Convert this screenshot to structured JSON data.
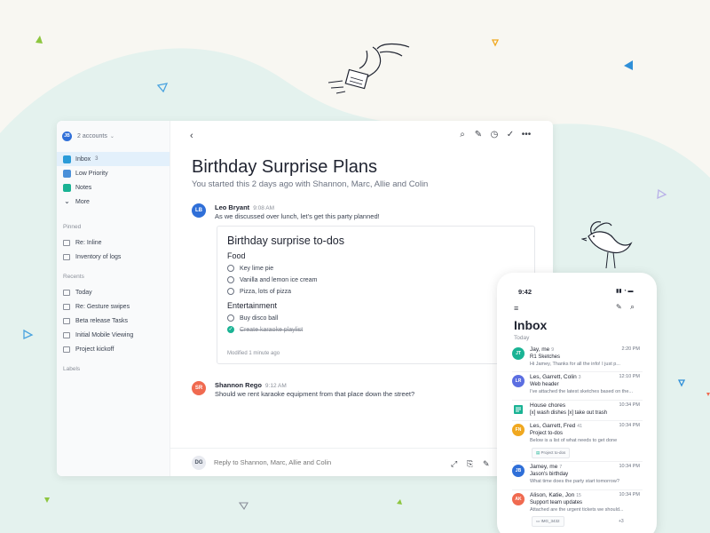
{
  "colors": {
    "accent": "#2f6fd8",
    "teal": "#1ab394",
    "background": "#f8f7f2",
    "blob": "#e4f2ee"
  },
  "desktop": {
    "account": {
      "initials": "JB",
      "label": "2 accounts"
    },
    "nav": [
      {
        "label": "Inbox",
        "badge": "3",
        "icon": "inbox-icon",
        "color": "#2a9bd8"
      },
      {
        "label": "Low Priority",
        "badge": "",
        "icon": "low-priority-icon",
        "color": "#4a90d9"
      },
      {
        "label": "Notes",
        "badge": "",
        "icon": "notes-icon",
        "color": "#1ab394"
      },
      {
        "label": "More",
        "badge": "",
        "icon": "chevron-down-icon",
        "color": ""
      }
    ],
    "pinned_label": "Pinned",
    "pinned": [
      "Re: Inline",
      "Inventory of logs"
    ],
    "recents_label": "Recents",
    "recents": [
      "Today",
      "Re: Gesture swipes",
      "Beta release Tasks",
      "Initial Mobile Viewing",
      "Project kickoff"
    ],
    "labels_label": "Labels",
    "thread": {
      "title": "Birthday Surprise Plans",
      "subtitle": "You started this 2 days ago with Shannon, Marc, Allie and Colin",
      "messages": [
        {
          "initials": "LB",
          "name": "Leo Bryant",
          "time": "9:08 AM",
          "body": "As we discussed over lunch, let's get this party planned!",
          "color": "#2f6fd8"
        },
        {
          "initials": "SR",
          "name": "Shannon Rego",
          "time": "9:12 AM",
          "body": "Should we rent karaoke equipment from that place down the street?",
          "color": "#f06a50"
        }
      ],
      "todo": {
        "title": "Birthday surprise to-dos",
        "sections": [
          {
            "heading": "Food",
            "items": [
              {
                "text": "Key lime pie",
                "done": false
              },
              {
                "text": "Vanilla and lemon ice cream",
                "done": false
              },
              {
                "text": "Pizza, lots of pizza",
                "done": false
              }
            ]
          },
          {
            "heading": "Entertainment",
            "items": [
              {
                "text": "Buy disco ball",
                "done": false
              },
              {
                "text": "Create karaoke playlist",
                "done": true
              }
            ]
          }
        ],
        "modified": "Modified 1 minute ago"
      },
      "reply": {
        "initials": "DG",
        "placeholder": "Reply to Shannon, Marc, Allie and Colin"
      }
    }
  },
  "phone": {
    "time": "9:42",
    "title": "Inbox",
    "section": "Today",
    "rows": [
      {
        "initials": "JT",
        "from": "Jay, me",
        "count": "9",
        "time": "2:20 PM",
        "subject": "R1 Sketches",
        "snippet": "Hi Jamey, Thanks for all the info! I just p...",
        "color": "#1ab394",
        "attachment": ""
      },
      {
        "initials": "LR",
        "from": "Les, Garrett, Colin",
        "count": "3",
        "time": "12:10 PM",
        "subject": "Web header",
        "snippet": "I've attached the latest sketches based on the...",
        "color": "#5b6ee1",
        "attachment": ""
      },
      {
        "initials": "",
        "from": "House chores",
        "count": "",
        "time": "10:34 PM",
        "subject": "[x] wash dishes [x] take out trash",
        "snippet": "",
        "color": "#1ab394",
        "attachment": ""
      },
      {
        "initials": "FN",
        "from": "Les, Garrett, Fred",
        "count": "41",
        "time": "10:34 PM",
        "subject": "Project to-dos",
        "snippet": "Below is a list of what needs to get done",
        "color": "#f0a820",
        "attachment": "Project to-dos"
      },
      {
        "initials": "JB",
        "from": "Jamey, me",
        "count": "7",
        "time": "10:34 PM",
        "subject": "Jason's birthday",
        "snippet": "What time does the party start tomorrow?",
        "color": "#2f6fd8",
        "attachment": ""
      },
      {
        "initials": "AK",
        "from": "Alison, Katie, Jon",
        "count": "15",
        "time": "10:34 PM",
        "subject": "Support team updates",
        "snippet": "Attached are the urgent tickets we should...",
        "color": "#f06a50",
        "attachment": "IMG_3432",
        "extra": "+3"
      }
    ]
  }
}
